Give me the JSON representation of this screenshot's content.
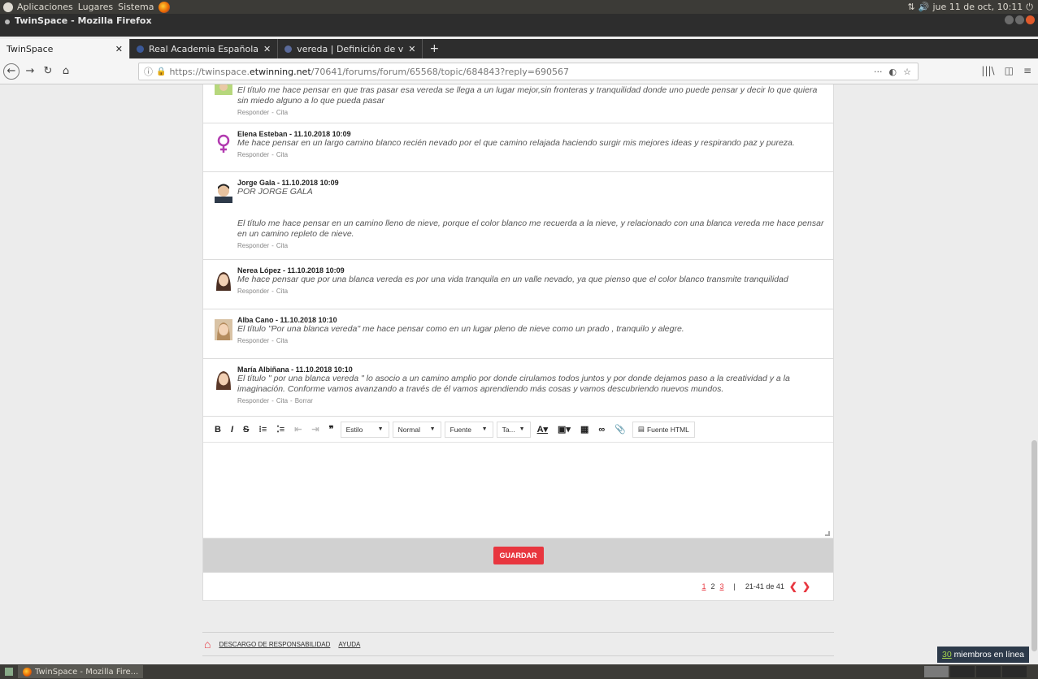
{
  "top_panel": {
    "menus": [
      "Aplicaciones",
      "Lugares",
      "Sistema"
    ],
    "clock": "jue 11 de oct, 10:11"
  },
  "window": {
    "title": "TwinSpace - Mozilla Firefox"
  },
  "tabs": [
    {
      "label": "TwinSpace"
    },
    {
      "label": "Real Academia Española"
    },
    {
      "label": "vereda | Definición de v"
    }
  ],
  "nav": {
    "url_prefix": "https://twinspace.",
    "url_domain": "etwinning.net",
    "url_path": "/70641/forums/forum/65568/topic/684843?reply=690567"
  },
  "posts": [
    {
      "author": "",
      "body": "El título me hace pensar en que tras pasar esa vereda se llega a un lugar mejor,sin fronteras y tranquilidad donde uno puede pensar y decir lo que quiera sin miedo alguno a lo que pueda pasar",
      "reply": "Responder",
      "quote": "Cita"
    },
    {
      "author": "Elena Esteban - 11.10.2018 10:09",
      "body": "Me hace pensar en un largo camino blanco recién nevado por el que camino relajada haciendo surgir mis mejores ideas y respirando paz y pureza.",
      "reply": "Responder",
      "quote": "Cita"
    },
    {
      "author": "Jorge Gala - 11.10.2018 10:09",
      "body_1": "POR JORGE GALA",
      "body": "El título me hace pensar en un camino lleno de nieve, porque el color blanco me recuerda a la nieve, y relacionado con una blanca vereda me hace pensar en un camino repleto de nieve.",
      "reply": "Responder",
      "quote": "Cita"
    },
    {
      "author": "Nerea López - 11.10.2018 10:09",
      "body": "Me hace pensar que por una blanca vereda es por una vida tranquila en un valle nevado, ya que pienso que el color blanco transmite tranquilidad",
      "reply": "Responder",
      "quote": "Cita"
    },
    {
      "author": "Alba Cano - 11.10.2018 10:10",
      "body": "El título \"Por una blanca vereda\" me hace pensar como en un lugar pleno de nieve como un prado , tranquilo y alegre.",
      "reply": "Responder",
      "quote": "Cita"
    },
    {
      "author": "María Albiñana - 11.10.2018 10:10",
      "body": "El título \" por una blanca vereda \" lo asocio a un camino amplio por donde cirulamos todos juntos y por donde dejamos paso a la creatividad y a la imaginación. Conforme vamos avanzando a través de él vamos aprendiendo más cosas y vamos descubriendo nuevos mundos.",
      "reply": "Responder",
      "quote": "Cita",
      "delete": "Borrar"
    }
  ],
  "editor": {
    "style": "Estilo",
    "format": "Normal",
    "font": "Fuente",
    "size": "Ta...",
    "source": "Fuente HTML",
    "save": "GUARDAR"
  },
  "pagination": {
    "pages": [
      "1",
      "2",
      "3"
    ],
    "range": "21-41 de 41"
  },
  "footer": {
    "disclaimer": "DESCARGO DE RESPONSABILIDAD",
    "help": "AYUDA"
  },
  "online": {
    "count": "30",
    "label": "miembros en línea"
  },
  "taskbar": {
    "task": "TwinSpace - Mozilla Fire..."
  }
}
